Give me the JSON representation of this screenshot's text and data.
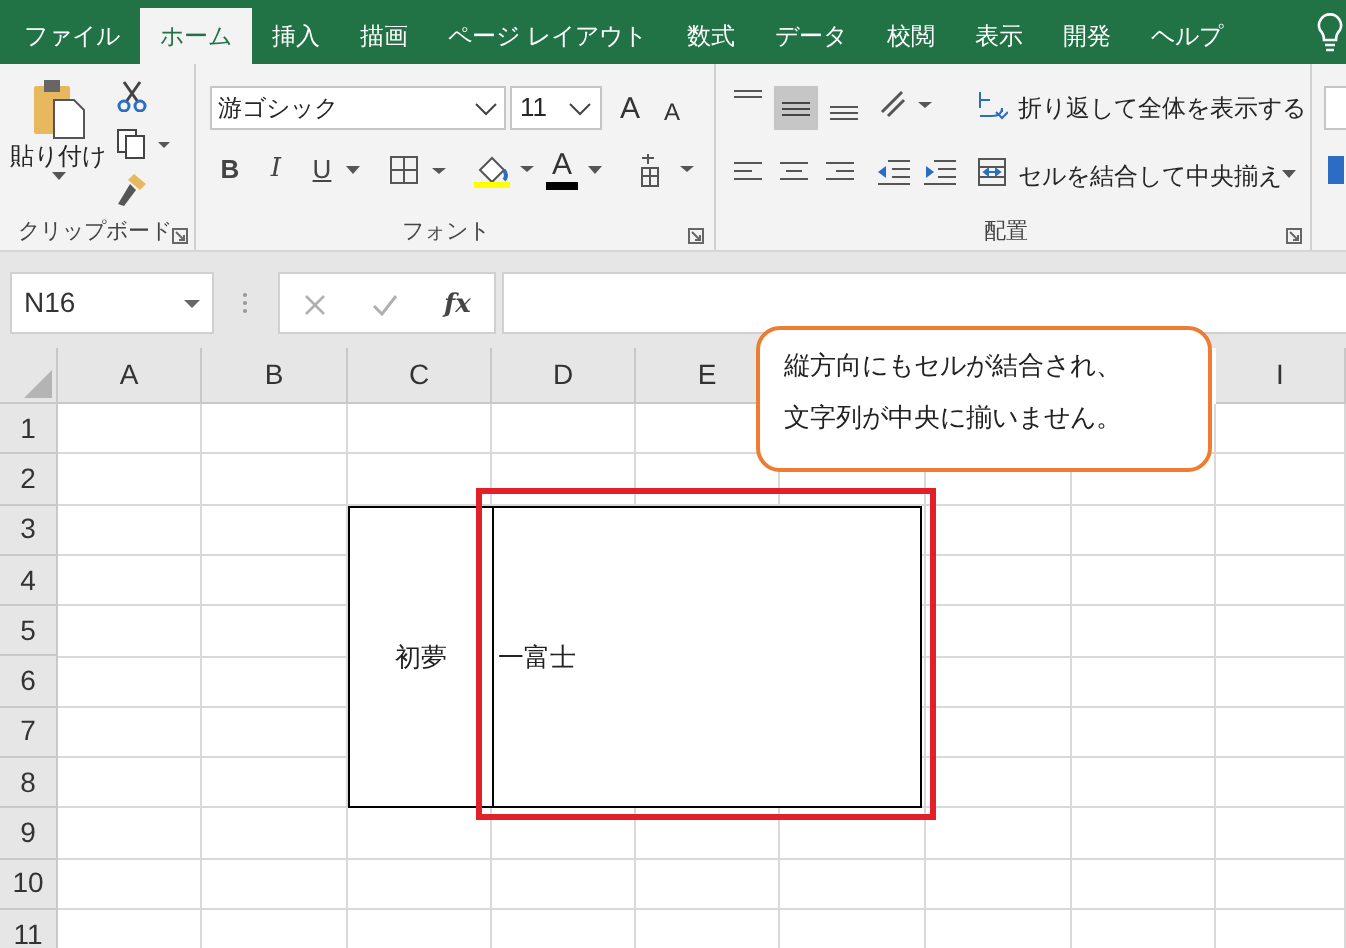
{
  "tabs": [
    {
      "label": "ファイル",
      "selected": false
    },
    {
      "label": "ホーム",
      "selected": true
    },
    {
      "label": "挿入",
      "selected": false
    },
    {
      "label": "描画",
      "selected": false
    },
    {
      "label": "ページ レイアウト",
      "selected": false
    },
    {
      "label": "数式",
      "selected": false
    },
    {
      "label": "データ",
      "selected": false
    },
    {
      "label": "校閲",
      "selected": false
    },
    {
      "label": "表示",
      "selected": false
    },
    {
      "label": "開発",
      "selected": false
    },
    {
      "label": "ヘルプ",
      "selected": false
    }
  ],
  "ribbon": {
    "clipboard": {
      "paste_label": "貼り付け",
      "group_label": "クリップボード"
    },
    "font": {
      "name": "游ゴシック",
      "size": "11",
      "grow": "A",
      "shrink": "A",
      "bold": "B",
      "italic": "I",
      "underline": "U",
      "font_color": "A",
      "group_label": "フォント"
    },
    "alignment": {
      "wrap_text": "折り返して全体を表示する",
      "merge_center": "セルを結合して中央揃え",
      "group_label": "配置"
    }
  },
  "formula_bar": {
    "name_box": "N16",
    "function_label": "fx"
  },
  "columns": [
    "A",
    "B",
    "C",
    "D",
    "E",
    "I"
  ],
  "rows": [
    "1",
    "2",
    "3",
    "4",
    "5",
    "6",
    "7",
    "8",
    "9",
    "10",
    "11"
  ],
  "merged_cells": [
    {
      "text": "初夢",
      "centered": true
    },
    {
      "text": "一富士",
      "centered": false
    }
  ],
  "callout": {
    "lines": [
      "縦方向にもセルが結合され、",
      "文字列が中央に揃いません。"
    ]
  }
}
